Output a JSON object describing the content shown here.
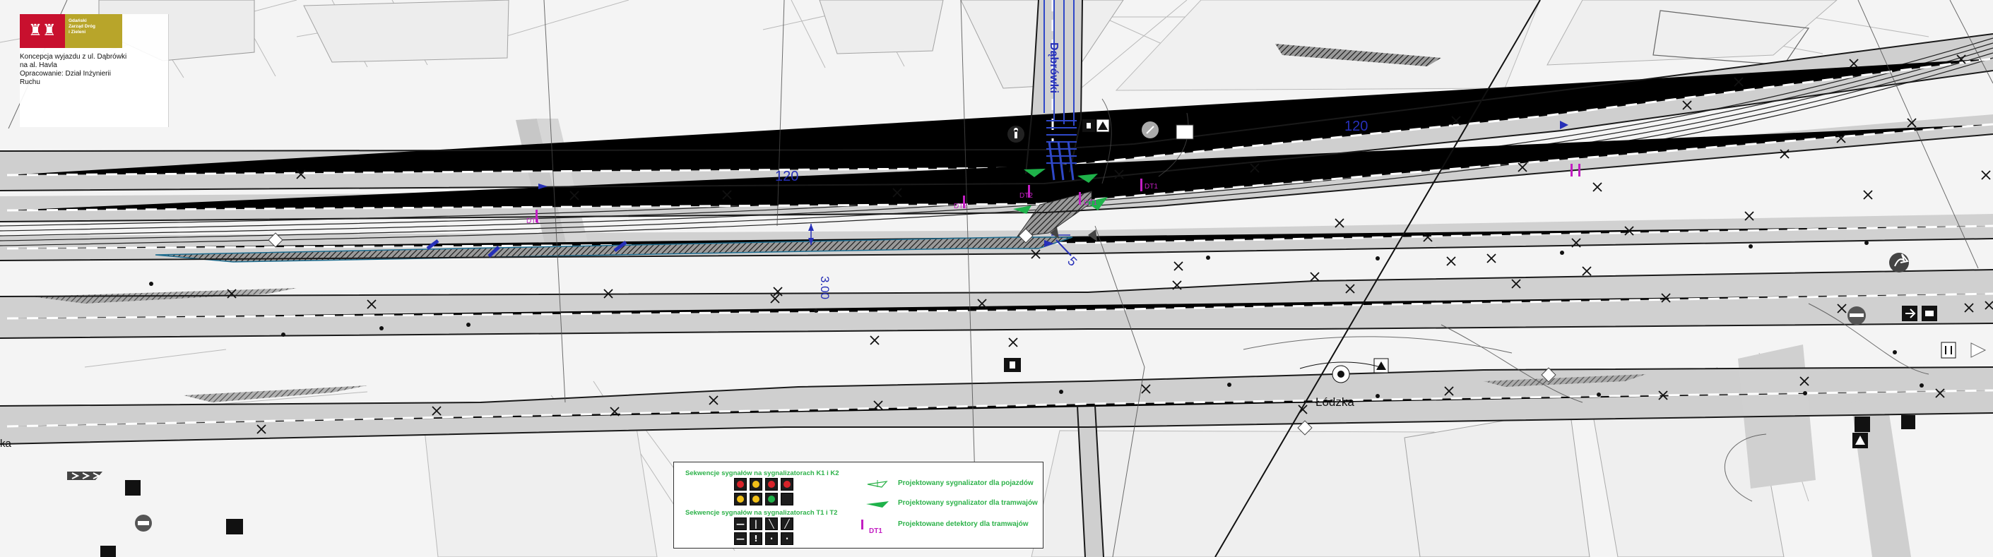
{
  "header": {
    "logo_mark": "♜♜",
    "logo_text_lines": [
      "Gdański",
      "Zarząd Dróg",
      "i Zieleni"
    ],
    "lines": [
      "Koncepcja wyjazdu z ul. Dąbrówki",
      "na al. Havla",
      "Opracowanie: Dział Inżynierii",
      "Ruchu"
    ]
  },
  "map": {
    "street_labels": {
      "dabrowki": "Dąbrówki",
      "lodzka": "Łódzka",
      "left_edge": "ka"
    },
    "dimensions": {
      "top_right_120": "120",
      "mid_120": "120",
      "vertical_300": "3.00",
      "diagonal_5": "5"
    },
    "detector_labels": [
      "DT1",
      "DT2",
      "DT2",
      "DT1",
      "DT1"
    ]
  },
  "legend": {
    "k_heading": "Sekwencje sygnałów na sygnalizatorach K1 i K2",
    "t_heading": "Sekwencje sygnałów na sygnalizatorach T1 i T2",
    "labels": [
      "Projektowany sygnalizator dla pojazdów",
      "Projektowany sygnalizator dla tramwajów",
      "Projektowane detektory dla tramwajów"
    ],
    "detector_code": "DT1",
    "k_sequence": [
      "red",
      "red-yellow",
      "green",
      "yellow"
    ],
    "t_sequence": [
      "stop",
      "go",
      "left",
      "right"
    ],
    "colors": {
      "signal_red": "#d8232a",
      "signal_yellow": "#f2c018",
      "signal_green": "#1fb24a",
      "legend_green": "#2db24a",
      "detector_magenta": "#c21ec2",
      "dimension_blue": "#2730b8"
    }
  }
}
